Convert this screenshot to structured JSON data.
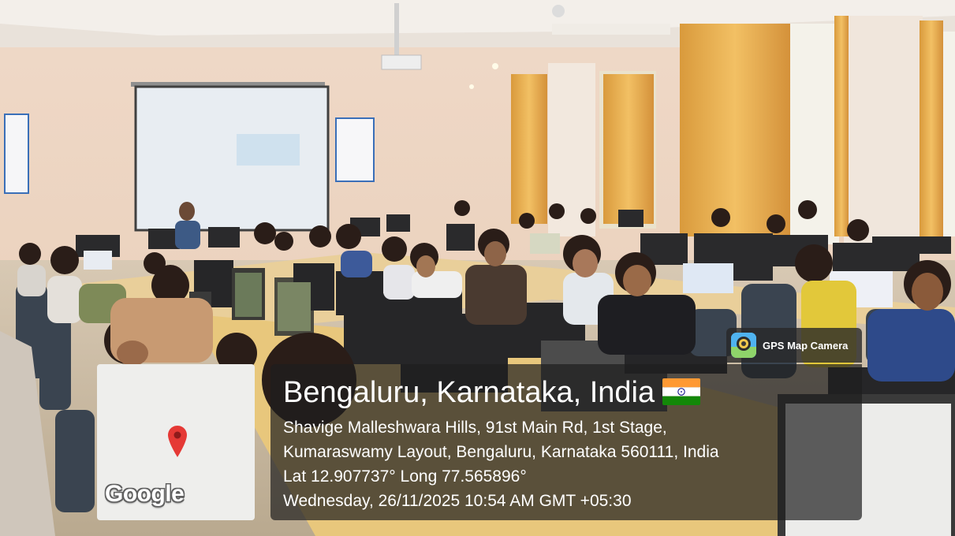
{
  "watermark": {
    "app_name": "GPS Map Camera",
    "app_icon": "map-camera-icon",
    "location_title": "Bengaluru, Karnataka, India",
    "flag_icon": "india-flag-icon",
    "address_line_1": "Shavige Malleshwara Hills, 91st Main Rd, 1st Stage,",
    "address_line_2": "Kumaraswamy Layout, Bengaluru, Karnataka 560111, India",
    "coordinates": "Lat 12.907737° Long 77.565896°",
    "datetime": "Wednesday, 26/11/2025 10:54 AM GMT +05:30"
  },
  "map": {
    "logo": "Google",
    "pin_icon": "map-pin-icon",
    "pin_color": "#e53935"
  }
}
